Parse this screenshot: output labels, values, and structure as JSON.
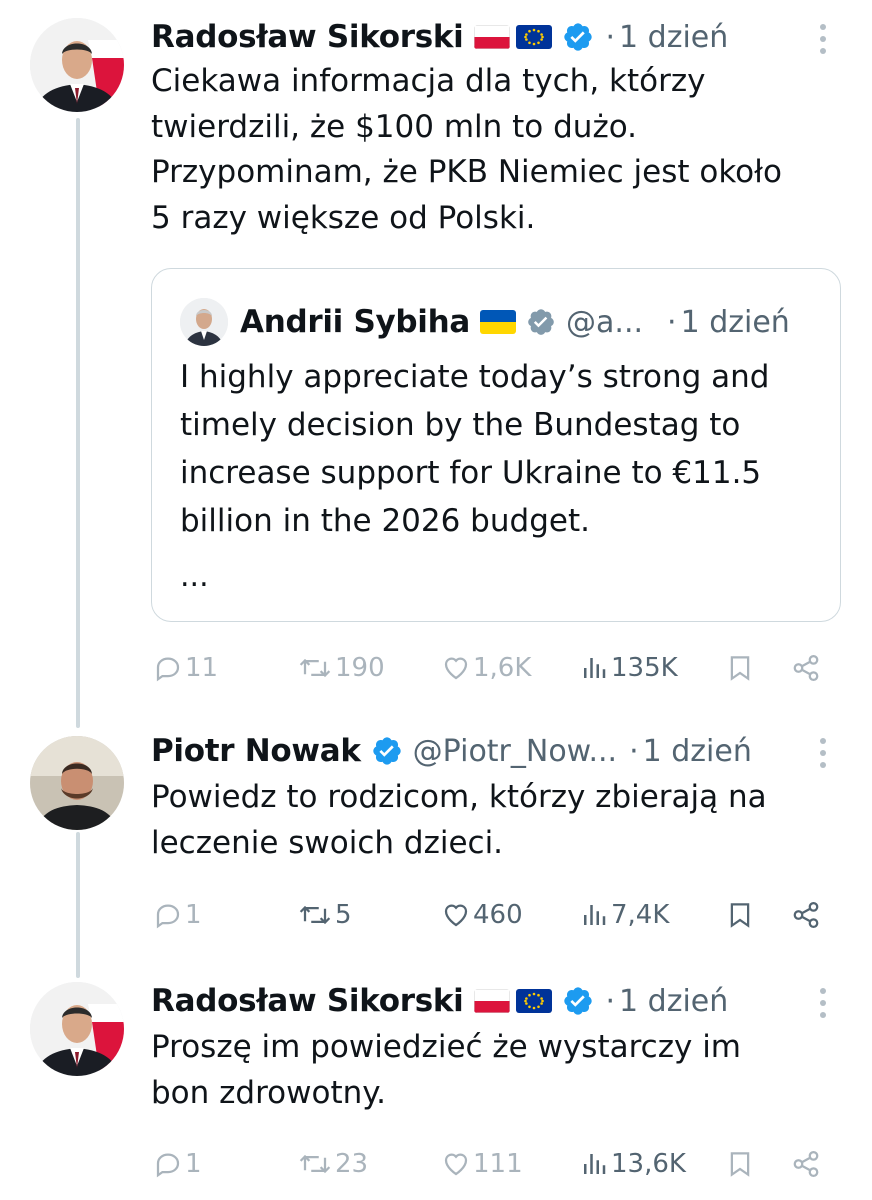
{
  "tweets": [
    {
      "author": "Radosław Sikorski",
      "time": "1 dzień",
      "text": "Ciekawa informacja dla tych, którzy\ntwierdzili, że $100 mln to dużo.\nPrzypominam, że PKB Niemiec jest około\n5 razy większe od Polski.",
      "quote": {
        "author": "Andrii Sybiha",
        "handle": "@a...",
        "time": "1 dzień",
        "text": "I highly appreciate today’s strong and\ntimely decision by the Bundestag to\nincrease support for Ukraine to €11.5\nbillion in the 2026 budget.",
        "ellipsis": "..."
      },
      "stats": {
        "replies": "11",
        "reposts": "190",
        "likes": "1,6K",
        "views": "135K"
      }
    },
    {
      "author": "Piotr Nowak",
      "handle": "@Piotr_Now...",
      "time": "1 dzień",
      "text": "Powiedz to rodzicom, którzy zbierają na\nleczenie swoich dzieci.",
      "stats": {
        "replies": "1",
        "reposts": "5",
        "likes": "460",
        "views": "7,4K"
      }
    },
    {
      "author": "Radosław Sikorski",
      "time": "1 dzień",
      "text": "Proszę im powiedzieć że wystarczy im\nbon zdrowotny.",
      "stats": {
        "replies": "1",
        "reposts": "23",
        "likes": "111",
        "views": "13,6K"
      }
    }
  ],
  "separator": "·",
  "colors": {
    "verified": "#1d9bf0",
    "muted": "#536471",
    "border": "#cfd9de"
  },
  "icons": [
    "reply-icon",
    "repost-icon",
    "like-icon",
    "views-icon",
    "bookmark-icon",
    "share-icon",
    "more-icon",
    "verified-icon",
    "poland-flag-icon",
    "eu-flag-icon",
    "ukraine-flag-icon"
  ]
}
